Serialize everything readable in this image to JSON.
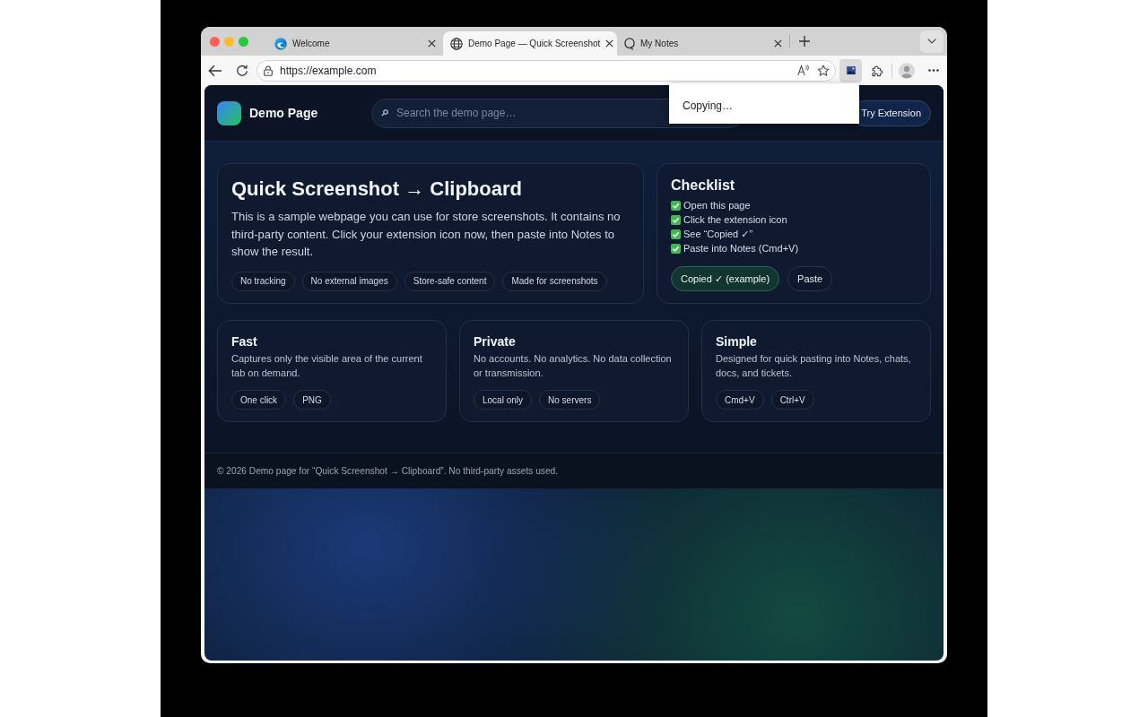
{
  "browser": {
    "tabs": [
      {
        "title": "Welcome",
        "selected": false
      },
      {
        "title": "Demo Page — Quick Screenshot",
        "selected": true
      },
      {
        "title": "My Notes",
        "selected": false
      }
    ],
    "address_bar": {
      "url": "https://example.com"
    },
    "toolbar": {
      "extension_pressed": true
    },
    "extension_popup": {
      "text": "Copying…"
    }
  },
  "page": {
    "header": {
      "brand": "Demo Page",
      "search": {
        "placeholder": "Search the demo page…"
      },
      "button": "Try Extension"
    },
    "hero": {
      "title": "Quick Screenshot → Clipboard",
      "text": "This is a sample webpage you can use for store screenshots. It contains no third-party content. Click your extension icon now, then paste into Notes to show the result.",
      "tags": [
        "No tracking",
        "No external images",
        "Store-safe content",
        "Made for screenshots"
      ]
    },
    "checklist": {
      "title": "Checklist",
      "items": [
        {
          "text": "Open this page",
          "checked": true
        },
        {
          "text": "Click the extension icon",
          "checked": true
        },
        {
          "text": "See “Copied ✓”",
          "checked": true
        },
        {
          "text": "Paste into Notes (Cmd+V)",
          "checked": true
        }
      ],
      "buttons": [
        {
          "label": "Copied ✓ (example)",
          "kind": "success"
        },
        {
          "label": "Paste",
          "kind": "plain"
        }
      ]
    },
    "features": [
      {
        "title": "Fast",
        "text": "Captures only the visible area of the current tab on demand.",
        "tags": [
          "One click",
          "PNG"
        ]
      },
      {
        "title": "Private",
        "text": "No accounts. No analytics. No data collection or transmission.",
        "tags": [
          "Local only",
          "No servers"
        ]
      },
      {
        "title": "Simple",
        "text": "Designed for quick pasting into Notes, chats, docs, and tickets.",
        "tags": [
          "Cmd+V",
          "Ctrl+V"
        ]
      }
    ],
    "footer": "© 2026 Demo page for “Quick Screenshot → Clipboard”. No third-party assets used."
  }
}
